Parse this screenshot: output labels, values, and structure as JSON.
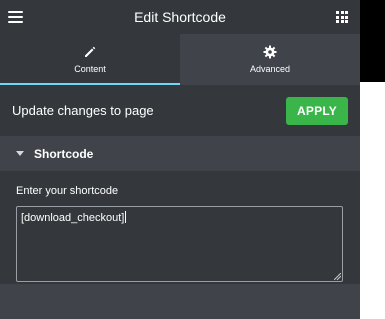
{
  "header": {
    "title": "Edit Shortcode"
  },
  "tabs": [
    {
      "label": "Content",
      "icon": "pencil-icon",
      "active": true
    },
    {
      "label": "Advanced",
      "icon": "gear-icon",
      "active": false
    }
  ],
  "update_bar": {
    "text": "Update changes to page",
    "apply_label": "APPLY"
  },
  "section": {
    "title": "Shortcode"
  },
  "field": {
    "label": "Enter your shortcode",
    "value": "[download_checkout]"
  },
  "colors": {
    "panel_dark": "#34383c",
    "panel_mid": "#404349",
    "accent_tab": "#71d7f7",
    "apply_green": "#39b54a"
  }
}
